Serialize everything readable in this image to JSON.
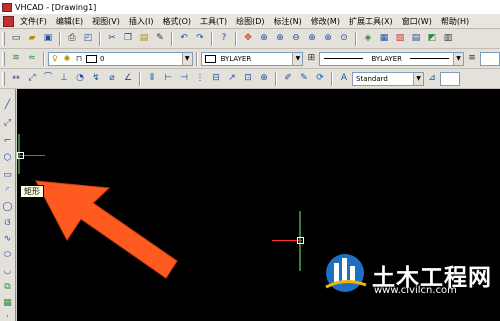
{
  "window": {
    "title": "VHCAD - [Drawing1]"
  },
  "menu": [
    {
      "label": "文件(F)"
    },
    {
      "label": "编辑(E)"
    },
    {
      "label": "视图(V)"
    },
    {
      "label": "插入(I)"
    },
    {
      "label": "格式(O)"
    },
    {
      "label": "工具(T)"
    },
    {
      "label": "绘图(D)"
    },
    {
      "label": "标注(N)"
    },
    {
      "label": "修改(M)"
    },
    {
      "label": "扩展工具(X)"
    },
    {
      "label": "窗口(W)"
    },
    {
      "label": "帮助(H)"
    }
  ],
  "layers": {
    "current_layer": "0"
  },
  "properties": {
    "color": "BYLAYER",
    "linetype": "BYLAYER"
  },
  "styles": {
    "text_style": "Standard"
  },
  "tooltip": {
    "text": "矩形"
  },
  "watermark": {
    "name": "土木工程网",
    "url": "www.civilcn.com"
  },
  "colors": {
    "canvas": "#000000",
    "arrow": "#ff5a1f",
    "crosshair": "#ff3030",
    "accent": "#1e4fa8"
  },
  "toolbars": {
    "standard_icons": [
      "new-icon",
      "open-icon",
      "save-icon",
      "print-icon",
      "preview-icon",
      "cut-icon",
      "copy-icon",
      "paste-icon",
      "match-icon",
      "undo-icon",
      "redo-icon",
      "help-icon",
      "pan-icon",
      "zoom-realtime-icon",
      "zoom-window-icon",
      "zoom-previous-icon",
      "zoom-in-icon",
      "zoom-out-icon",
      "zoom-all-icon",
      "properties-icon",
      "design-center-icon",
      "tool-palette-icon",
      "sheet-icon",
      "markup-icon",
      "calc-icon"
    ],
    "draw_tools": [
      "line-icon",
      "construction-line-icon",
      "polyline-icon",
      "polygon-icon",
      "rectangle-icon",
      "arc-icon",
      "circle-icon",
      "revcloud-icon",
      "spline-icon",
      "ellipse-icon",
      "ellipse-arc-icon",
      "insert-block-icon",
      "make-block-icon",
      "point-icon",
      "hatch-icon"
    ]
  }
}
